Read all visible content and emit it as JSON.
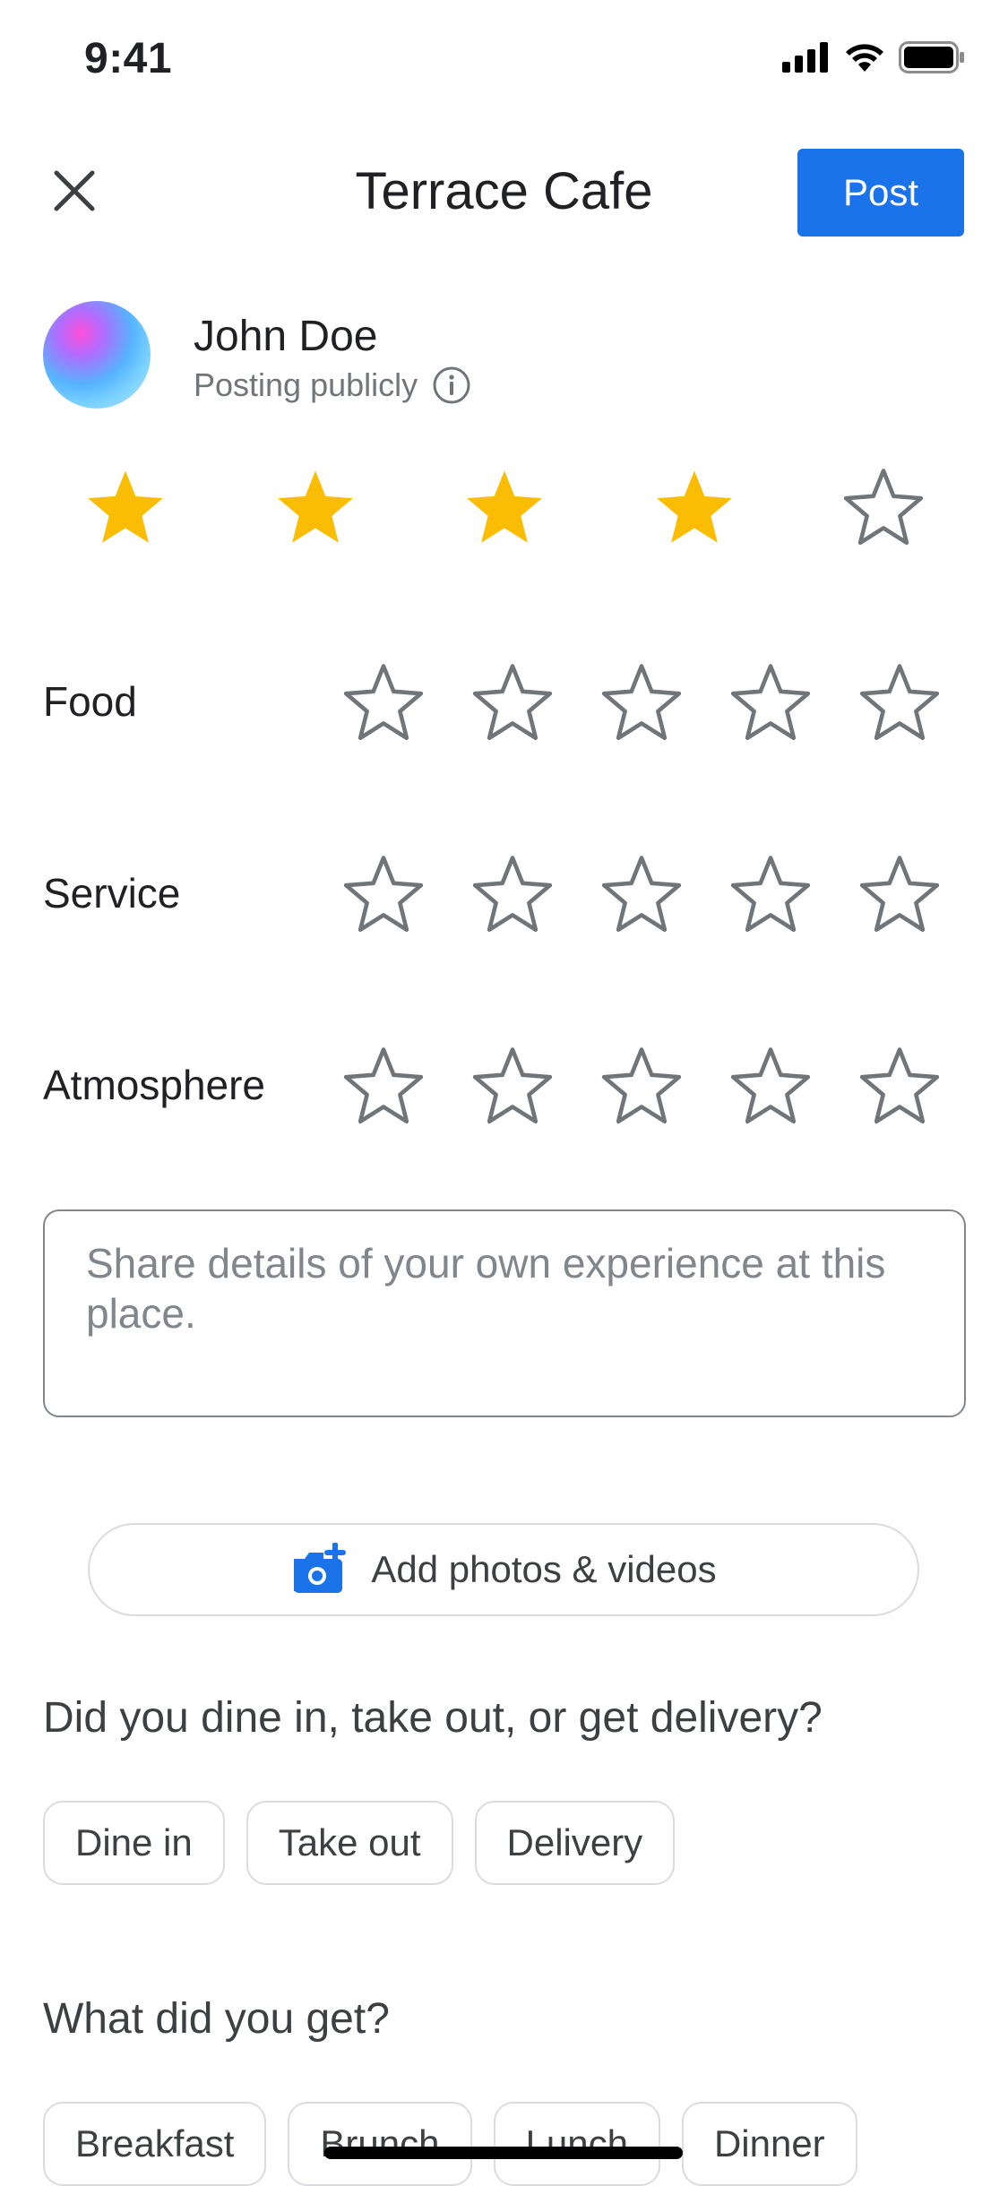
{
  "status_bar": {
    "time": "9:41"
  },
  "header": {
    "title": "Terrace Cafe",
    "post_label": "Post"
  },
  "user": {
    "name": "John Doe",
    "visibility": "Posting publicly"
  },
  "overall_rating": {
    "value": 4,
    "max": 5
  },
  "categories": [
    {
      "label": "Food",
      "value": 0,
      "max": 5
    },
    {
      "label": "Service",
      "value": 0,
      "max": 5
    },
    {
      "label": "Atmosphere",
      "value": 0,
      "max": 5
    }
  ],
  "review": {
    "placeholder": "Share details of your own experience at this place."
  },
  "add_photos": {
    "label": "Add photos & videos"
  },
  "dine_question": {
    "text": "Did you dine in, take out, or get delivery?",
    "options": [
      "Dine in",
      "Take out",
      "Delivery"
    ]
  },
  "meal_question": {
    "text": "What did you get?",
    "options": [
      "Breakfast",
      "Brunch",
      "Lunch",
      "Dinner"
    ]
  },
  "colors": {
    "accent": "#1a73e8",
    "star_filled": "#fbbc04",
    "star_empty": "#70757a"
  },
  "icons": [
    "close-icon",
    "info-icon",
    "add-photo-camera-icon",
    "cellular-signal-icon",
    "wifi-icon",
    "battery-icon"
  ]
}
